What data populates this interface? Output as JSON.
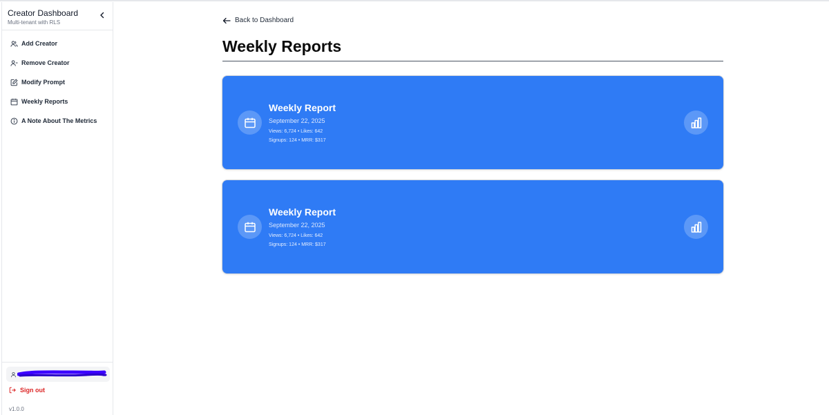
{
  "sidebar": {
    "title": "Creator Dashboard",
    "subtitle": "Multi-tenant with RLS",
    "collapse_icon": "chevron-left-icon",
    "items": [
      {
        "label": "Add Creator",
        "icon": "users-icon"
      },
      {
        "label": "Remove Creator",
        "icon": "user-minus-icon"
      },
      {
        "label": "Modify Prompt",
        "icon": "edit-icon"
      },
      {
        "label": "Weekly Reports",
        "icon": "calendar-icon"
      },
      {
        "label": "A Note About The Metrics",
        "icon": "info-icon"
      }
    ],
    "user_icon": "user-icon",
    "signout_label": "Sign out",
    "version": "v1.0.0"
  },
  "main": {
    "back_label": "Back to Dashboard",
    "page_title": "Weekly Reports",
    "reports": [
      {
        "title": "Weekly Report",
        "date": "September 22, 2025",
        "line1": "Views: 6,724 • Likes: 642",
        "line2": "Signups: 124 • MRR: $317"
      },
      {
        "title": "Weekly Report",
        "date": "September 22, 2025",
        "line1": "Views: 6,724 • Likes: 642",
        "line2": "Signups: 124 • MRR: $317"
      }
    ]
  },
  "colors": {
    "card_blue": "#2f7bf5",
    "signout_red": "#dc2626",
    "redaction_purple": "#3b00ff"
  }
}
